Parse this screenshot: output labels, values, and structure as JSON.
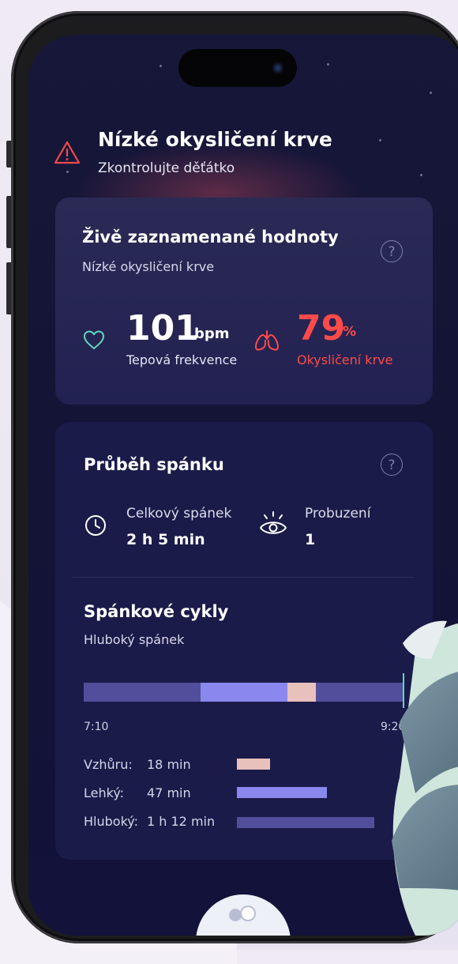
{
  "alert": {
    "title": "Nízké okysličení krve",
    "subtitle": "Zkontrolujte děťátko",
    "icon": "warning-triangle-icon",
    "color": "#ef4b4b"
  },
  "live_card": {
    "title": "Živě zaznamenané hodnoty",
    "subtitle": "Nízké okysličení krve",
    "help_label": "?",
    "heart_rate": {
      "value": "101",
      "unit": "bpm",
      "label": "Tepová frekvence",
      "icon": "heart-icon",
      "color": "#5fd6c2"
    },
    "oxygen": {
      "value": "79",
      "unit": "%",
      "label": "Okysličení krve",
      "icon": "lungs-icon",
      "color": "#ff4a4a"
    }
  },
  "sleep_card": {
    "title": "Průběh spánku",
    "help_label": "?",
    "total": {
      "label": "Celkový spánek",
      "value": "2 h 5 min",
      "icon": "clock-icon"
    },
    "wakeups": {
      "label": "Probuzení",
      "value": "1",
      "icon": "eye-icon"
    },
    "cycles": {
      "title": "Spánkové cykly",
      "subtitle": "Hluboký spánek",
      "start_time": "7:10",
      "end_time": "9:20",
      "legend": [
        {
          "label": "Vzhůru:",
          "value": "18 min",
          "color": "#e8c1bc",
          "fraction": 0.14
        },
        {
          "label": "Lehký:",
          "value": "47 min",
          "color": "#8a87ee",
          "fraction": 0.38
        },
        {
          "label": "Hluboký:",
          "value": "1 h 12 min",
          "color": "#514f9c",
          "fraction": 0.58
        }
      ]
    }
  },
  "colors": {
    "deep": "#514f9c",
    "light": "#8a87ee",
    "awake": "#e8c1bc",
    "accent_teal": "#5fd6c2",
    "alert_red": "#ff4a4a"
  }
}
